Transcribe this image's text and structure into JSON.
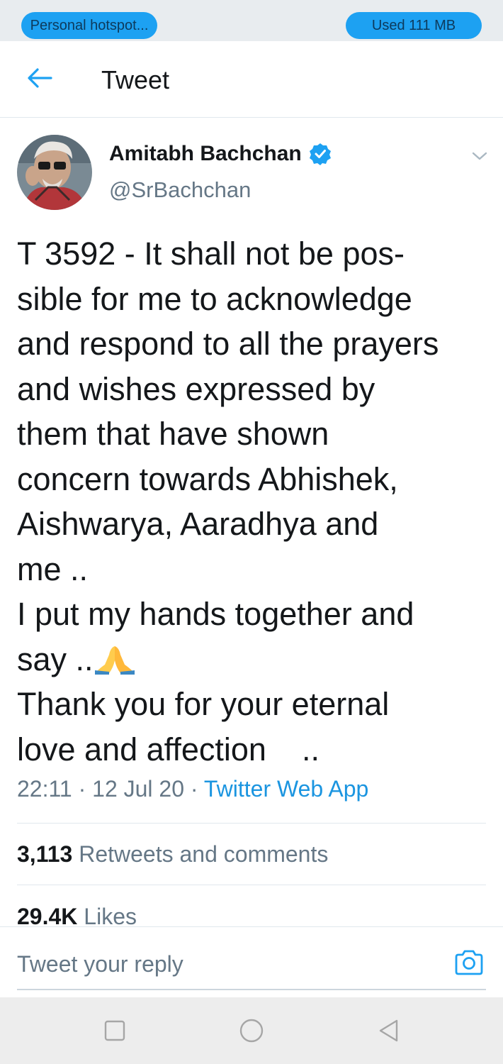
{
  "status_bar": {
    "hotspot_label": "Personal hotspot...",
    "data_usage_label": "Used  111 MB"
  },
  "header": {
    "title": "Tweet",
    "back_icon": "arrow-left-icon"
  },
  "tweet": {
    "author_name": "Amitabh Bachchan",
    "handle": "@SrBachchan",
    "verified_icon": "verified-badge-icon",
    "text_lines": [
      "T 3592 - It shall not be pos-",
      "sible for me to acknowledge",
      "and respond to all the prayers",
      "and wishes expressed by",
      "them that have shown",
      "concern towards Abhishek,",
      "Aishwarya, Aaradhya and",
      "me ..",
      "I put my hands together and",
      "say ..",
      "Thank you for your eternal",
      "love and affection    .."
    ],
    "emoji_icon": "folded-hands-icon",
    "time": "22:11",
    "date": "12 Jul 20",
    "source": "Twitter Web App",
    "meta_separator": " · "
  },
  "stats": {
    "retweets_count": "3,113",
    "retweets_label": "Retweets and comments",
    "likes_count": "29.4K",
    "likes_label": "Likes"
  },
  "reply": {
    "placeholder": "Tweet your reply",
    "camera_icon": "camera-icon"
  },
  "colors": {
    "accent": "#1da1f2",
    "link": "#1b95e0",
    "text_primary": "#14171a",
    "text_secondary": "#657786"
  }
}
